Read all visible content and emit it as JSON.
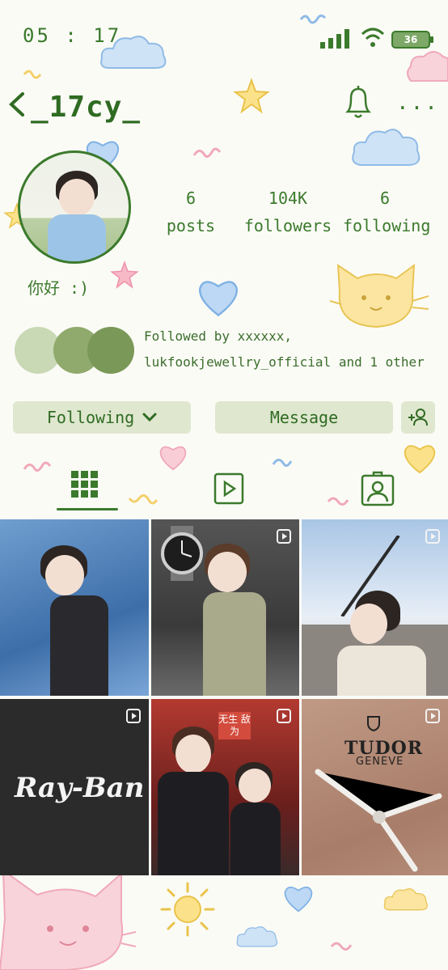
{
  "status_bar": {
    "time": "05 : 17",
    "battery": "36"
  },
  "header": {
    "username": "_17cy_",
    "more": "..."
  },
  "profile": {
    "bio": "你好 :)",
    "stats": [
      {
        "value": "6",
        "label": "posts"
      },
      {
        "value": "104K",
        "label": "followers"
      },
      {
        "value": "6",
        "label": "following"
      }
    ],
    "followed_by": {
      "line1": "Followed by xxxxxx,",
      "line2": "lukfookjewellry_official and 1 other"
    }
  },
  "actions": {
    "following": "Following",
    "message": "Message"
  },
  "grid": {
    "tile4_logo": "Ray-Ban",
    "tile5_poster": "无生 敌为",
    "tile6_logo": "TUDOR",
    "tile6_sub": "GENEVE"
  },
  "colors": {
    "accent": "#3b7a2c",
    "button_bg": "#dfe7cf",
    "background": "#fbfbf6"
  }
}
